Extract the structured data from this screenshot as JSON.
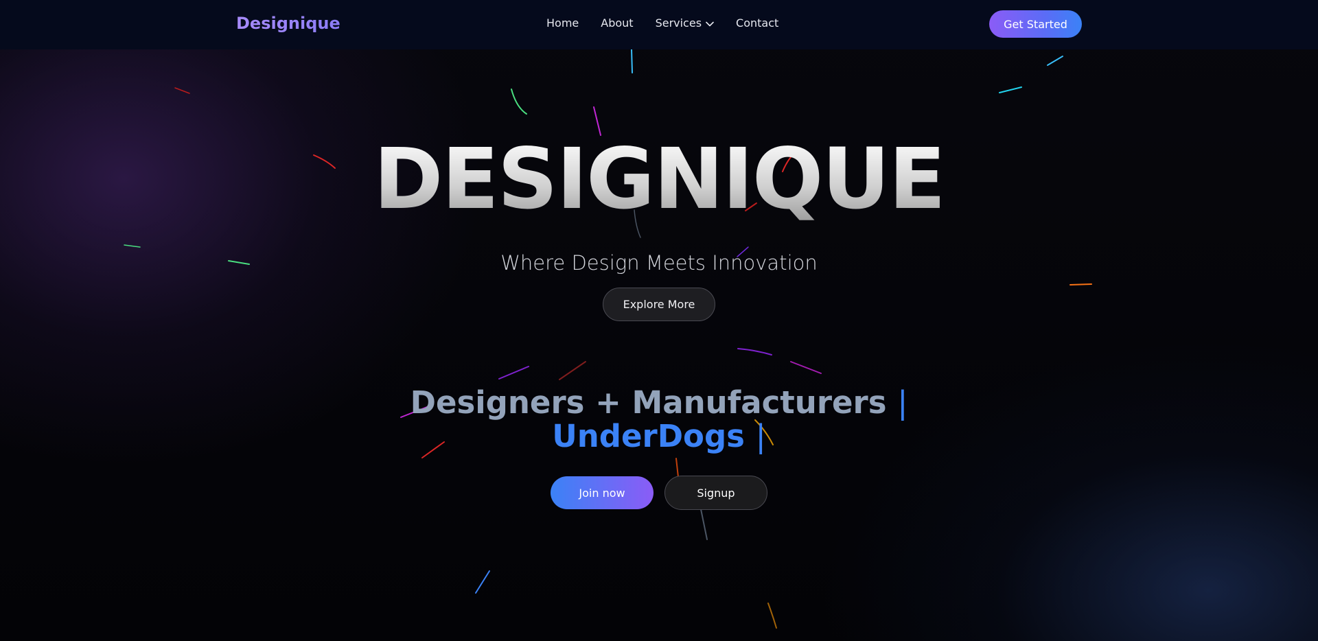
{
  "nav": {
    "logo": "Designique",
    "links": [
      "Home",
      "About",
      "Services",
      "Contact"
    ],
    "cta": "Get Started"
  },
  "hero": {
    "title": "DESIGNIQUE",
    "tagline": "Where Design Meets Innovation",
    "explore_label": "Explore More"
  },
  "headline": {
    "line1": "Designers + Manufacturers",
    "line2": "UnderDogs",
    "cursor": "|"
  },
  "actions": {
    "join_label": "Join now",
    "signup_label": "Signup"
  },
  "colors": {
    "accent_purple": "#8b5cf6",
    "accent_blue": "#3b82f6",
    "nav_bg": "#050a1c"
  }
}
